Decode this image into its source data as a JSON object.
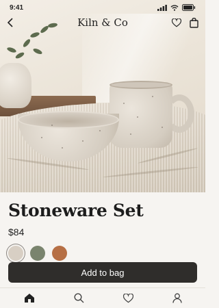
{
  "status": {
    "time": "9:41",
    "icons": [
      "signal-icon",
      "wifi-icon",
      "battery-icon"
    ]
  },
  "navbar": {
    "brand": "Kiln & Co",
    "icons": [
      "back-icon",
      "heart-icon",
      "bag-icon"
    ]
  },
  "product": {
    "title": "Stoneware Set",
    "price": "$84",
    "swatches": [
      {
        "name": "speckled-cream",
        "color": "#d8cfc4",
        "selected": true
      },
      {
        "name": "sage",
        "color": "#7a846e",
        "selected": false
      },
      {
        "name": "terracotta",
        "color": "#b66f45",
        "selected": false
      }
    ],
    "cta_label": "Add to bag"
  },
  "tabbar": {
    "icons": [
      "home-icon",
      "search-icon",
      "heart-icon",
      "profile-icon"
    ],
    "active": "home-icon"
  },
  "colors": {
    "accent": "#2f2d2b",
    "background": "#f6f4f1"
  }
}
